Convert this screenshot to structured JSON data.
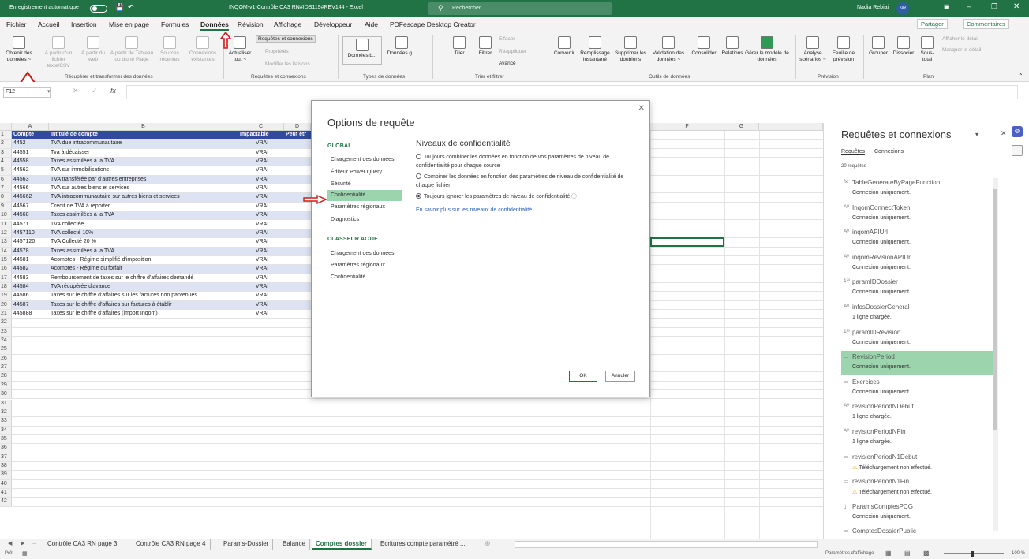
{
  "titlebar": {
    "autosave": "Enregistrement automatique",
    "filename": "INQOM-v1-Contrôle CA3 RN#IDS119#REV144  -  Excel",
    "search": "Rechercher",
    "user": "Nadia Rebiai",
    "initials": "NR"
  },
  "menu": {
    "items": [
      "Fichier",
      "Accueil",
      "Insertion",
      "Mise en page",
      "Formules",
      "Données",
      "Révision",
      "Affichage",
      "Développeur",
      "Aide",
      "PDFescape Desktop Creator"
    ],
    "share": "Partager",
    "comments": "Commentaires"
  },
  "ribbon": {
    "get": [
      "Obtenir des données ~",
      "À partir d'un fichier texte/CSV",
      "À partir du web",
      "À partir de Tableau ou d'une Plage",
      "Sources récentes",
      "Connexions existantes"
    ],
    "group1": "Récupérer et transformer des données",
    "refresh": "Actualiser tout ~",
    "rq": [
      "Requêtes et connexions",
      "Propriétés",
      "Modifier les liaisons"
    ],
    "group2": "Requêtes et connexions",
    "datatypes": [
      "Données b...",
      "Données g..."
    ],
    "group3": "Types de données",
    "sort": [
      "Trier",
      "Filtrer"
    ],
    "filter_small": [
      "Effacer",
      "Réappliquer",
      "Avancé"
    ],
    "group4": "Trier et filtrer",
    "tools": [
      "Convertir",
      "Remplissage instantané",
      "Supprimer les doublons",
      "Validation des données ~",
      "Consolider",
      "Relations",
      "Gérer le modèle de données"
    ],
    "group5": "Outils de données",
    "forecast": [
      "Analyse scénarios ~",
      "Feuille de prévision"
    ],
    "group6": "Prévision",
    "outline": [
      "Grouper",
      "Dissocier",
      "Sous-total"
    ],
    "outline_small": [
      "Afficher le détail",
      "Masquer le détail"
    ],
    "group7": "Plan"
  },
  "namebox": "F12",
  "sheet": {
    "columns": [
      "A",
      "B",
      "C",
      "D",
      "E",
      "F",
      "G"
    ],
    "headers": [
      "Compte",
      "Intitulé de compte",
      "Impactable",
      "Peut êtr"
    ],
    "rows": [
      [
        "4452",
        "TVA due intracommunautaire",
        "VRAI"
      ],
      [
        "44551",
        "Tva à décaisser",
        "VRAI"
      ],
      [
        "44558",
        "Taxes assimilées à la TVA",
        "VRAI"
      ],
      [
        "44562",
        "TVA sur immobilisations",
        "VRAI"
      ],
      [
        "44563",
        "TVA transférée par d'autres entreprises",
        "VRAI"
      ],
      [
        "44566",
        "TVA sur autres biens et services",
        "VRAI"
      ],
      [
        "445662",
        "TVA intracommunautaire sur autres biens et services",
        "VRAI"
      ],
      [
        "44567",
        "Crédit de TVA à reporter",
        "VRAI"
      ],
      [
        "44568",
        "Taxes assimilées à la TVA",
        "VRAI"
      ],
      [
        "44571",
        "TVA collectée",
        "VRAI"
      ],
      [
        "4457110",
        "TVA collecté 10%",
        "VRAI"
      ],
      [
        "4457120",
        "TVA Collecté 20 %",
        "VRAI"
      ],
      [
        "44578",
        "Taxes assimilées à la TVA",
        "VRAI"
      ],
      [
        "44581",
        "Acomptes - Régime simplifié d'imposition",
        "VRAI"
      ],
      [
        "44582",
        "Acomptes - Régime du forfait",
        "VRAI"
      ],
      [
        "44583",
        "Remboursement de taxes sur le chiffre d'affaires demandé",
        "VRAI"
      ],
      [
        "44584",
        "TVA récupérée d'avance",
        "VRAI"
      ],
      [
        "44586",
        "Taxes sur le chiffre d'affaires sur les factures non parvenues",
        "VRAI"
      ],
      [
        "44587",
        "Taxes sur le chiffre d'affaires sur factures à établir",
        "VRAI"
      ],
      [
        "445888",
        "Taxes sur le chiffre d'affaires (import Inqom)",
        "VRAI"
      ]
    ],
    "row_numbers": [
      "1",
      "2",
      "3",
      "4",
      "5",
      "6",
      "7",
      "8",
      "9",
      "10",
      "11",
      "12",
      "13",
      "14",
      "15",
      "16",
      "17",
      "18",
      "19",
      "20",
      "21",
      "22",
      "23",
      "24",
      "25",
      "26",
      "27",
      "28",
      "29",
      "30",
      "31",
      "32",
      "33",
      "34",
      "35",
      "36",
      "37",
      "38",
      "39",
      "40",
      "41",
      "42"
    ]
  },
  "dialog": {
    "title": "Options de requête",
    "global": "GLOBAL",
    "global_items": [
      "Chargement des données",
      "Éditeur Power Query",
      "Sécurité",
      "Confidentialité",
      "Paramètres régionaux",
      "Diagnostics"
    ],
    "workbook": "CLASSEUR ACTIF",
    "workbook_items": [
      "Chargement des données",
      "Paramètres régionaux",
      "Confidentialité"
    ],
    "heading": "Niveaux de confidentialité",
    "options": [
      "Toujours combiner les données en fonction de vos paramètres de niveau de confidentialité pour chaque source",
      "Combiner les données en fonction des paramètres de niveau de confidentialité de chaque fichier",
      "Toujours ignorer les paramètres de niveau de confidentialité"
    ],
    "link": "En savoir plus sur les niveaux de confidentialité",
    "ok": "OK",
    "cancel": "Annuler"
  },
  "pane": {
    "title": "Requêtes et connexions",
    "tab1": "Requêtes",
    "tab2": "Connexions",
    "count": "20 requêtes",
    "queries": [
      {
        "name": "TableGenerateByPageFunction",
        "sub": "Connexion uniquement.",
        "icon": "fx"
      },
      {
        "name": "InqomConnectToken",
        "sub": "Connexion uniquement.",
        "icon": "ABC"
      },
      {
        "name": "inqomAPIUrl",
        "sub": "Connexion uniquement.",
        "icon": "ABC"
      },
      {
        "name": "inqomRevisionAPIUrl",
        "sub": "Connexion uniquement.",
        "icon": "ABC"
      },
      {
        "name": "paramIDDossier",
        "sub": "Connexion uniquement.",
        "icon": "123"
      },
      {
        "name": "infosDossierGeneral",
        "sub": "1 ligne chargée.",
        "icon": "ABC"
      },
      {
        "name": "paramIDRevision",
        "sub": "Connexion uniquement.",
        "icon": "123"
      },
      {
        "name": "RevisionPeriod",
        "sub": "Connexion uniquement.",
        "icon": "table"
      },
      {
        "name": "Exercices",
        "sub": "Connexion uniquement.",
        "icon": "table"
      },
      {
        "name": "revisionPeriodNDebut",
        "sub": "1 ligne chargée.",
        "icon": "ABC"
      },
      {
        "name": "revisionPeriodNFin",
        "sub": "1 ligne chargée.",
        "icon": "ABC"
      },
      {
        "name": "revisionPeriodN1Debut",
        "sub": "Téléchargement non effectué.",
        "icon": "warn"
      },
      {
        "name": "revisionPeriodN1Fin",
        "sub": "Téléchargement non effectué.",
        "icon": "warn"
      },
      {
        "name": "ParamsComptesPCG",
        "sub": "Connexion uniquement.",
        "icon": "doc"
      },
      {
        "name": "ComptesDossierPublic",
        "sub": "",
        "icon": "table"
      }
    ]
  },
  "tabs": [
    "Contrôle CA3 RN page 3",
    "Contrôle CA3 RN page 4",
    "Params-Dossier",
    "Balance",
    "Comptes dossier",
    "Ecritures compte paramétré  ..."
  ],
  "active_tab": "Comptes dossier",
  "status": {
    "ready": "Prêt",
    "display": "Paramètres d'affichage",
    "zoom": "100 %"
  }
}
